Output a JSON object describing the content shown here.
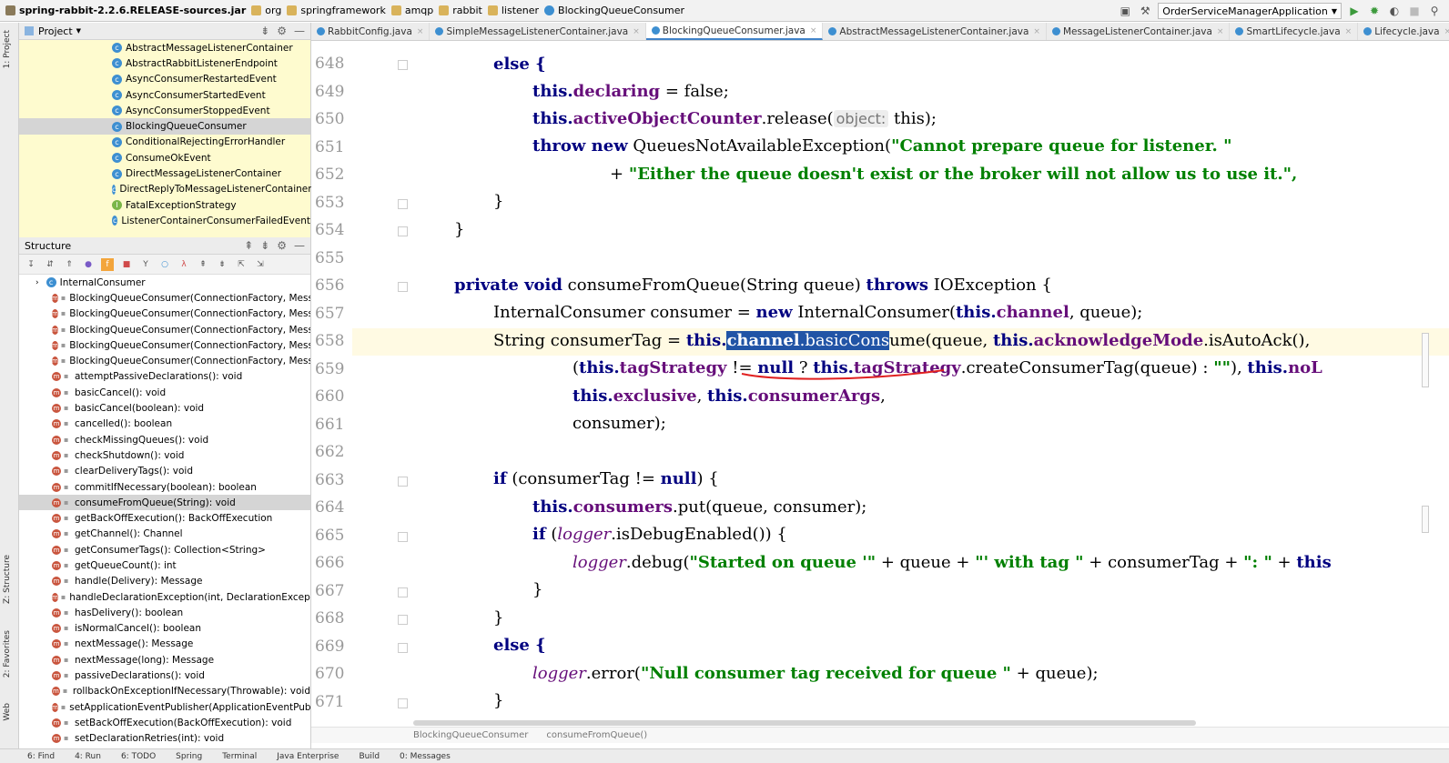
{
  "breadcrumb": [
    "spring-rabbit-2.2.6.RELEASE-sources.jar",
    "org",
    "springframework",
    "amqp",
    "rabbit",
    "listener",
    "BlockingQueueConsumer"
  ],
  "run_config": "OrderServiceManagerApplication",
  "left_strip": {
    "project": "1: Project",
    "structure": "Z: Structure",
    "favorites": "2: Favorites",
    "web": "Web"
  },
  "project_panel": {
    "title": "Project",
    "items": [
      "AbstractMessageListenerContainer",
      "AbstractRabbitListenerEndpoint",
      "AsyncConsumerRestartedEvent",
      "AsyncConsumerStartedEvent",
      "AsyncConsumerStoppedEvent",
      "BlockingQueueConsumer",
      "ConditionalRejectingErrorHandler",
      "ConsumeOkEvent",
      "DirectMessageListenerContainer",
      "DirectReplyToMessageListenerContainer",
      "FatalExceptionStrategy",
      "ListenerContainerConsumerFailedEvent"
    ],
    "selected": 5
  },
  "structure_panel": {
    "title": "Structure",
    "root": "InternalConsumer",
    "items": [
      "BlockingQueueConsumer(ConnectionFactory, Messag",
      "BlockingQueueConsumer(ConnectionFactory, Messag",
      "BlockingQueueConsumer(ConnectionFactory, Messag",
      "BlockingQueueConsumer(ConnectionFactory, Messag",
      "BlockingQueueConsumer(ConnectionFactory, Messag",
      "attemptPassiveDeclarations(): void",
      "basicCancel(): void",
      "basicCancel(boolean): void",
      "cancelled(): boolean",
      "checkMissingQueues(): void",
      "checkShutdown(): void",
      "clearDeliveryTags(): void",
      "commitIfNecessary(boolean): boolean",
      "consumeFromQueue(String): void",
      "getBackOffExecution(): BackOffExecution",
      "getChannel(): Channel",
      "getConsumerTags(): Collection<String>",
      "getQueueCount(): int",
      "handle(Delivery): Message",
      "handleDeclarationException(int, DeclarationException)",
      "hasDelivery(): boolean",
      "isNormalCancel(): boolean",
      "nextMessage(): Message",
      "nextMessage(long): Message",
      "passiveDeclarations(): void",
      "rollbackOnExceptionIfNecessary(Throwable): void",
      "setApplicationEventPublisher(ApplicationEventPublishe",
      "setBackOffExecution(BackOffExecution): void",
      "setDeclarationRetries(int): void"
    ],
    "selected": 13
  },
  "editor_tabs": [
    "RabbitConfig.java",
    "SimpleMessageListenerContainer.java",
    "BlockingQueueConsumer.java",
    "AbstractMessageListenerContainer.java",
    "MessageListenerContainer.java",
    "SmartLifecycle.java",
    "Lifecycle.java"
  ],
  "active_tab": 2,
  "line_numbers": [
    "648",
    "649",
    "650",
    "651",
    "652",
    "653",
    "654",
    "655",
    "656",
    "657",
    "658",
    "659",
    "660",
    "661",
    "662",
    "663",
    "664",
    "665",
    "666",
    "667",
    "668",
    "669",
    "670",
    "671"
  ],
  "code": {
    "l648_else": "else {",
    "l649_this": "this.",
    "l649_field": "declaring",
    "l649_rest": " = false;",
    "l650_this": "this.",
    "l650_field": "activeObjectCounter",
    "l650_call": ".release(",
    "l650_hint": "object:",
    "l650_rest": " this);",
    "l651_kw": "throw new",
    "l651_type": " QueuesNotAvailableException(",
    "l651_str": "\"Cannot prepare queue for listener. \"",
    "l652_plus": "+ ",
    "l652_str": "\"Either the queue doesn't exist or the broker will not allow us to use it.\",",
    "l653": "}",
    "l654": "}",
    "l656_kw": "private void",
    "l656_sig": " consumeFromQueue(String queue) ",
    "l656_throws": "throws",
    "l656_rest": " IOException {",
    "l657_a": "InternalConsumer consumer = ",
    "l657_new": "new",
    "l657_b": " InternalConsumer(",
    "l657_this": "this.",
    "l657_field": "channel",
    "l657_rest": ", queue);",
    "l658_a": "String consumerTag = ",
    "l658_this": "this.",
    "l658_sel_field": "channel",
    "l658_sel_rest": ".basicCons",
    "l658_after": "ume(queue, ",
    "l658_this2": "this.",
    "l658_field2": "acknowledgeMode",
    "l658_rest": ".isAutoAck(),",
    "l659_a": "(",
    "l659_this": "this.",
    "l659_field": "tagStrategy",
    "l659_b": " != ",
    "l659_null": "null",
    "l659_c": " ? ",
    "l659_this2": "this.",
    "l659_field2": "tagStrategy",
    "l659_d": ".createConsumerTag(queue) : ",
    "l659_str": "\"\"",
    "l659_e": "), ",
    "l659_this3": "this.",
    "l659_field3": "noL",
    "l660_this": "this.",
    "l660_field": "exclusive",
    "l660_mid": ", ",
    "l660_this2": "this.",
    "l660_field2": "consumerArgs",
    "l660_rest": ",",
    "l661": "consumer);",
    "l663_if": "if",
    "l663_a": " (consumerTag != ",
    "l663_null": "null",
    "l663_b": ") {",
    "l664_this": "this.",
    "l664_field": "consumers",
    "l664_rest": ".put(queue, consumer);",
    "l665_if": "if",
    "l665_a": " (",
    "l665_logger": "logger",
    "l665_rest": ".isDebugEnabled()) {",
    "l666_logger": "logger",
    "l666_a": ".debug(",
    "l666_s1": "\"Started on queue '\"",
    "l666_b": " + queue + ",
    "l666_s2": "\"' with tag \"",
    "l666_c": " + consumerTag + ",
    "l666_s3": "\": \"",
    "l666_d": " + ",
    "l666_this": "this",
    "l667": "}",
    "l668": "}",
    "l669_else": "else {",
    "l670_logger": "logger",
    "l670_a": ".error(",
    "l670_str": "\"Null consumer tag received for queue \"",
    "l670_rest": " + queue);",
    "l671": "}"
  },
  "editor_breadcrumb": [
    "BlockingQueueConsumer",
    "consumeFromQueue()"
  ],
  "bottom_bar": [
    "6: Find",
    "4: Run",
    "6: TODO",
    "Spring",
    "Terminal",
    "Java Enterprise",
    "Build",
    "0: Messages"
  ]
}
